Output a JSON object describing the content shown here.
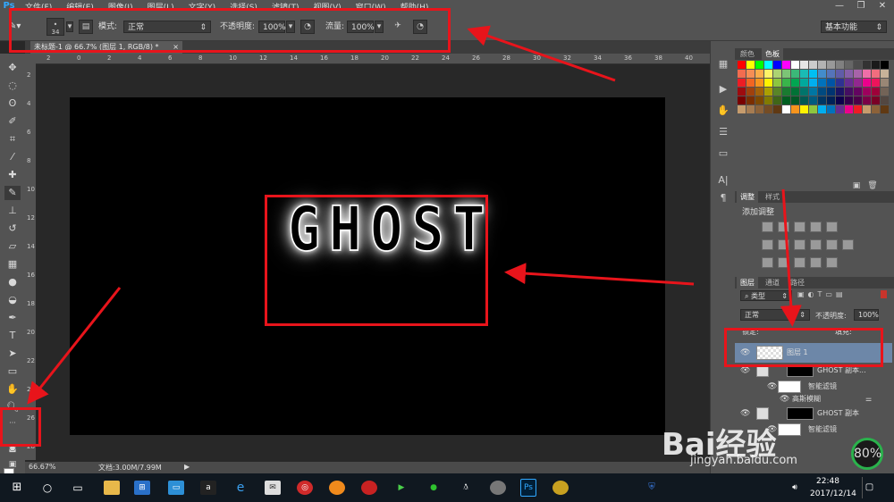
{
  "app": {
    "logo": "Ps"
  },
  "menu": [
    "文件(F)",
    "编辑(E)",
    "图像(I)",
    "图层(L)",
    "文字(Y)",
    "选择(S)",
    "滤镜(T)",
    "视图(V)",
    "窗口(W)",
    "帮助(H)"
  ],
  "window_controls": {
    "minimize": "—",
    "restore": "❐",
    "close": "✕"
  },
  "options": {
    "brush_size": "34",
    "mode_label": "模式:",
    "mode_value": "正常",
    "opacity_label": "不透明度:",
    "opacity_value": "100%",
    "flow_label": "流量:",
    "flow_value": "100%",
    "workspace": "基本功能"
  },
  "document": {
    "tab_title": "未标题-1 @ 66.7% (图层 1, RGB/8) *",
    "close": "×"
  },
  "ruler_top": [
    "2",
    "0",
    "2",
    "4",
    "6",
    "8",
    "10",
    "12",
    "14",
    "16",
    "18",
    "20",
    "22",
    "24",
    "26",
    "28",
    "30",
    "32",
    "34",
    "36",
    "38",
    "40"
  ],
  "ruler_left": [
    "2",
    "4",
    "6",
    "8",
    "10",
    "12",
    "14",
    "16",
    "18",
    "20",
    "22",
    "24",
    "26",
    "28"
  ],
  "canvas_text": "GHOST",
  "status": {
    "zoom": "66.67%",
    "doc": "文档:3.00M/7.99M"
  },
  "panels": {
    "swatch_tabs": [
      "颜色",
      "色板"
    ],
    "adjust_tabs": [
      "调整",
      "样式"
    ],
    "adjust_title": "添加调整",
    "layer_tabs": [
      "图层",
      "通道",
      "路径"
    ],
    "filter_kind": "类型",
    "blend_mode": "正常",
    "opacity_label": "不透明度:",
    "opacity_value": "100%",
    "lock_label": "锁定:",
    "fill_label": "填充:",
    "layers": [
      {
        "name": "图层 1"
      },
      {
        "name": "GHOST 副本..."
      },
      {
        "name": "智能滤镜"
      },
      {
        "name": "高斯模糊"
      },
      {
        "name": "GHOST 副本"
      },
      {
        "name": "智能滤镜"
      }
    ]
  },
  "swatch_colors": [
    "#ff0000",
    "#ffff00",
    "#00ff00",
    "#00ffff",
    "#0000ff",
    "#ff00ff",
    "#ffffff",
    "#e6e6e6",
    "#cccccc",
    "#b3b3b3",
    "#999999",
    "#808080",
    "#666666",
    "#4d4d4d",
    "#333333",
    "#1a1a1a",
    "#000000",
    "#f26c4f",
    "#f68e55",
    "#fbad4a",
    "#fff467",
    "#acd372",
    "#7cc576",
    "#3bb878",
    "#1abbb4",
    "#00bff3",
    "#438ccb",
    "#5574b9",
    "#605ca8",
    "#855fa8",
    "#a763a9",
    "#ef6ea8",
    "#f16d7e",
    "#c7b299",
    "#ed1c24",
    "#f26522",
    "#f7941d",
    "#fff200",
    "#8dc63f",
    "#39b54a",
    "#00a651",
    "#00a99d",
    "#00aeef",
    "#0072bc",
    "#0054a6",
    "#2e3192",
    "#662d91",
    "#92278f",
    "#ec008c",
    "#ed145b",
    "#998675",
    "#9e0b0f",
    "#a0410d",
    "#a36209",
    "#aba000",
    "#598527",
    "#197b30",
    "#007236",
    "#00746b",
    "#0076a3",
    "#004a80",
    "#003471",
    "#1b1464",
    "#440e62",
    "#630460",
    "#9e005d",
    "#9e0039",
    "#736357",
    "#790000",
    "#7b2e00",
    "#7d4900",
    "#827b00",
    "#406618",
    "#005e20",
    "#005826",
    "#005952",
    "#005b7f",
    "#003663",
    "#002157",
    "#0d004c",
    "#32004b",
    "#4b0049",
    "#7b0046",
    "#7a0026",
    "#534741",
    "#c69c6d",
    "#a67c52",
    "#8c6239",
    "#754c24",
    "#603913",
    "#ffffff",
    "#f7941d",
    "#fff200",
    "#8dc63f",
    "#00aeef",
    "#0072bc",
    "#662d91",
    "#ec008c",
    "#ed1c24",
    "#c69c6d",
    "#8c6239",
    "#603913"
  ],
  "taskbar": {
    "time": "22:48",
    "date": "2017/12/14"
  },
  "watermark": {
    "brand": "Bai经验",
    "url": "jingyan.baidu.com",
    "badge": "80%"
  },
  "colors": {
    "annotation": "#e8141b",
    "canvas": "#000000",
    "ui_panel": "#535353",
    "badge_ring": "#2ab24c"
  }
}
